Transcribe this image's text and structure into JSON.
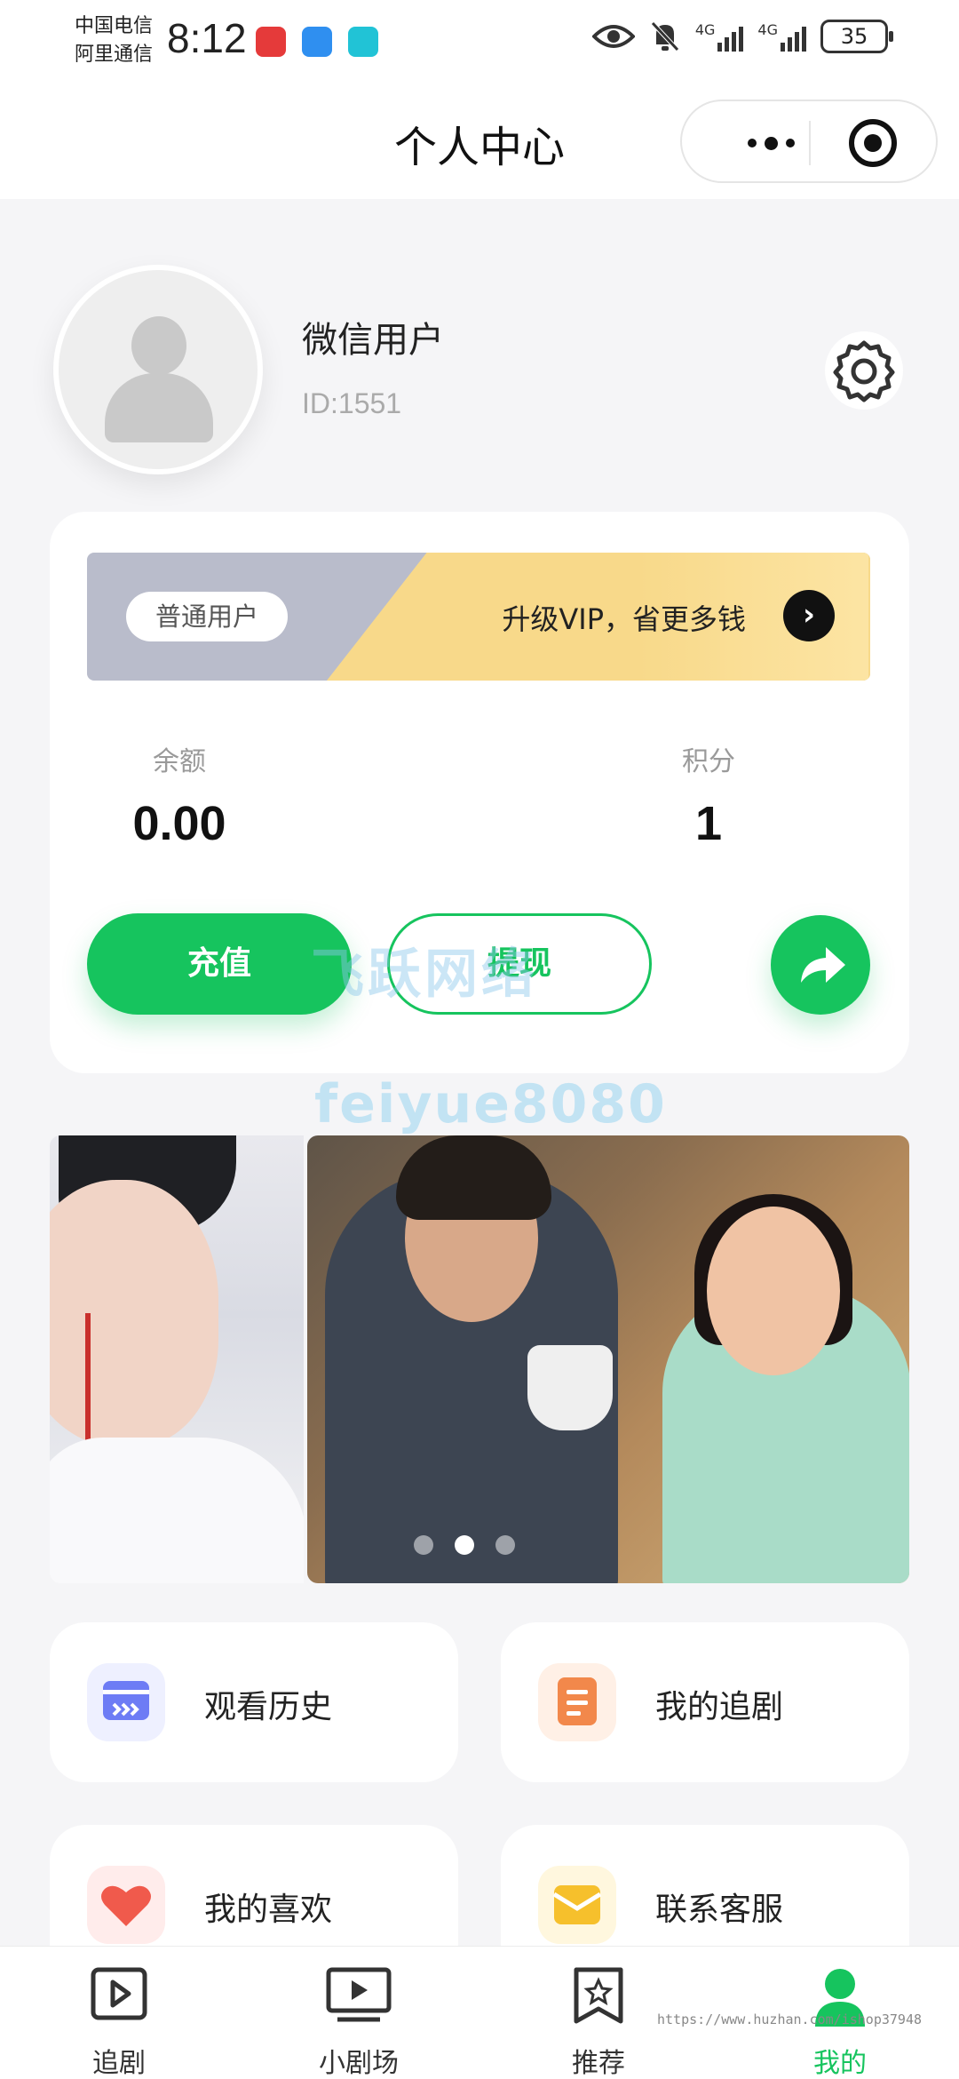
{
  "status_bar": {
    "carrier1": "中国电信",
    "carrier2": "阿里通信",
    "time": "8:12",
    "network1": "4G",
    "network2": "4G",
    "battery": "35"
  },
  "navbar": {
    "title": "个人中心"
  },
  "profile": {
    "username": "微信用户",
    "user_id": "ID:1551"
  },
  "vip": {
    "level": "普通用户",
    "upgrade_text": "升级VIP，省更多钱"
  },
  "wallet": {
    "balance_label": "余额",
    "balance_value": "0.00",
    "points_label": "积分",
    "points_value": "1",
    "recharge_label": "充值",
    "withdraw_label": "提现"
  },
  "watermark": {
    "cn": "飞跃网络",
    "en": "feiyue8080",
    "url": "https://www.huzhan.com/ishop37948"
  },
  "banner": {
    "slide_count": 3,
    "active_index": 1
  },
  "menu": [
    {
      "label": "观看历史",
      "icon": "history-icon",
      "color": "#6d7cf5"
    },
    {
      "label": "我的追剧",
      "icon": "follow-list-icon",
      "color": "#f2884b"
    },
    {
      "label": "我的喜欢",
      "icon": "heart-icon",
      "color": "#f05a4c"
    },
    {
      "label": "联系客服",
      "icon": "customer-service-icon",
      "color": "#f6c02c"
    }
  ],
  "tabbar": [
    {
      "label": "追剧",
      "icon": "play-box-icon"
    },
    {
      "label": "小剧场",
      "icon": "tv-icon"
    },
    {
      "label": "推荐",
      "icon": "star-bookmark-icon"
    },
    {
      "label": "我的",
      "icon": "user-icon",
      "active": true
    }
  ],
  "colors": {
    "accent": "#16c45e",
    "vip_gold": "#f8d98a",
    "vip_gray": "#b9bccb"
  }
}
